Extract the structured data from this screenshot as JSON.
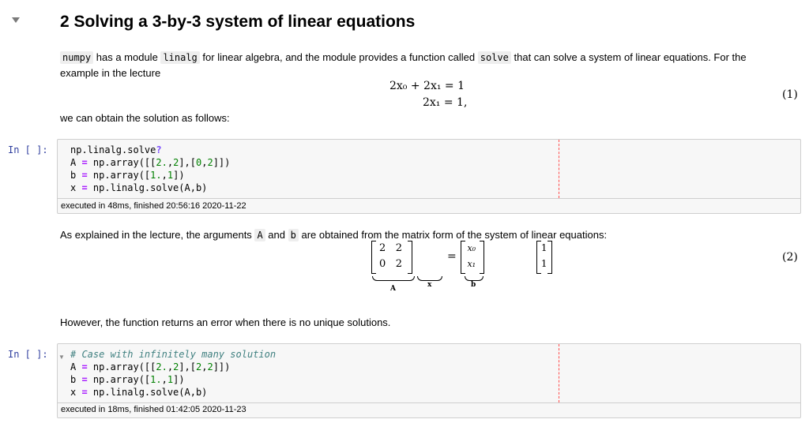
{
  "heading": "2 Solving a 3-by-3 system of linear equations",
  "intro": {
    "code1": "numpy",
    "text1": "has a module",
    "code2": "linalg",
    "text2": "for linear algebra, and the module provides a function called",
    "code3": "solve",
    "text3": "that can solve a system of linear equations. For the",
    "line2": "example in the lecture"
  },
  "equations": {
    "eq1": "2x₀ + 2x₁ = 1",
    "eq2": "2x₁ = 1,",
    "number": "(1)"
  },
  "obtain_text": "we can obtain the solution as follows:",
  "cell1": {
    "prompt": "In [ ]:",
    "exec_text": "executed in 48ms, finished 20:56:16 2020-11-22"
  },
  "explain": {
    "text1": "As explained in the lecture, the arguments",
    "code1": "A",
    "text2": "and",
    "code2": "b",
    "text3": "are obtained from the matrix form of the system of linear equations:"
  },
  "matrix_eq": {
    "A": [
      [
        "2",
        "2"
      ],
      [
        "0",
        "2"
      ]
    ],
    "x": [
      "x₀",
      "x₁"
    ],
    "equals": "=",
    "b": [
      "1",
      "1"
    ],
    "label_A": "A",
    "label_x": "x",
    "label_b": "b",
    "number": "(2)"
  },
  "however_text": "However, the function returns an error when there is no unique solutions.",
  "cell2": {
    "prompt": "In [ ]:",
    "arrow": "▼",
    "comment": "# Case with infinitely many solution",
    "exec_text": "executed in 18ms, finished 01:42:05 2020-11-23"
  }
}
